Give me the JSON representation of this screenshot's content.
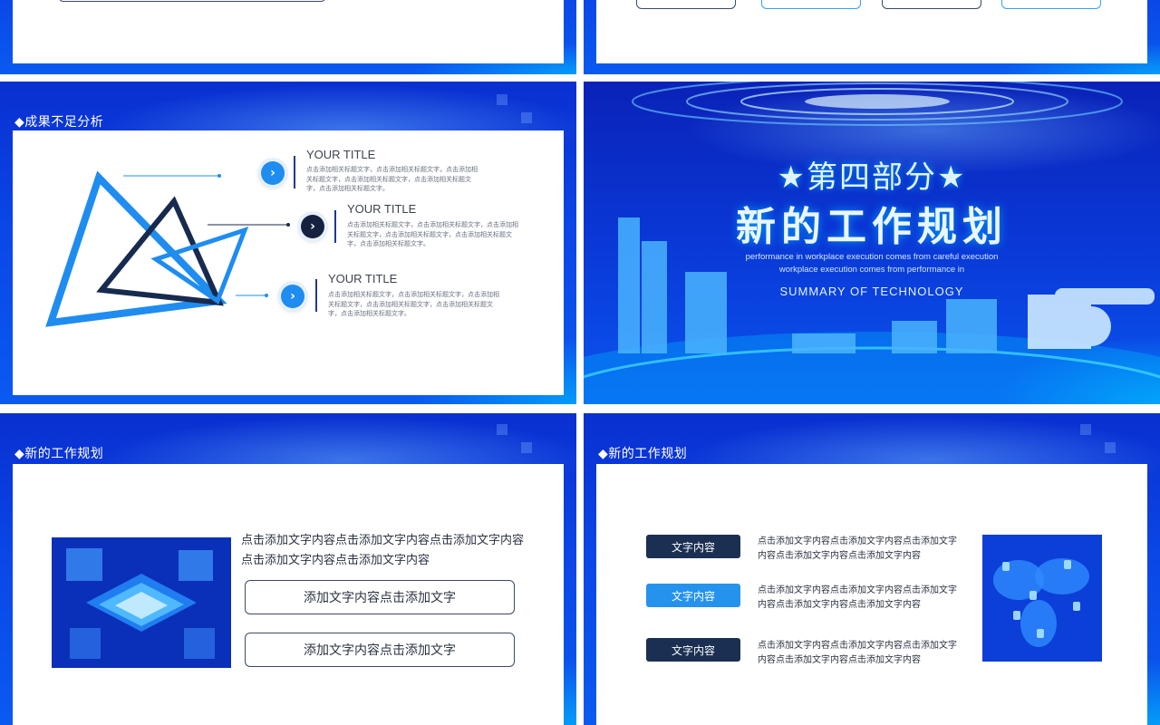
{
  "slide3": {
    "section_title": "◆成果不足分析",
    "items": [
      {
        "title": "YOUR TITLE",
        "text": "点击添加相关标题文字，点击添加相关标题文字，点击添加相关标题文字，点击添加相关标题文字，点击添加相关标题文字，点击添加相关标题文字。"
      },
      {
        "title": "YOUR TITLE",
        "text": "点击添加相关标题文字，点击添加相关标题文字，点击添加相关标题文字，点击添加相关标题文字，点击添加相关标题文字，点击添加相关标题文字。"
      },
      {
        "title": "YOUR TITLE",
        "text": "点击添加相关标题文字，点击添加相关标题文字，点击添加相关标题文字，点击添加相关标题文字，点击添加相关标题文字，点击添加相关标题文字。"
      }
    ],
    "chevron": "›"
  },
  "slide4": {
    "kicker": "★第四部分★",
    "title": "新的工作规划",
    "en_line1": "performance in workplace execution comes from careful execution",
    "en_line2": "workplace execution comes from performance in",
    "summary": "SUMMARY OF TECHNOLOGY"
  },
  "slide5": {
    "section_title": "◆新的工作规划",
    "body_line1": "点击添加文字内容点击添加文字内容点击添加文字内容",
    "body_line2": "点击添加文字内容点击添加文字内容",
    "box1": "添加文字内容点击添加文字",
    "box2": "添加文字内容点击添加文字"
  },
  "slide6": {
    "section_title": "◆新的工作规划",
    "rows": [
      {
        "label": "文字内容",
        "text1": "点击添加文字内容点击添加文字内容点击添加文字",
        "text2": "内容点击添加文字内容点击添加文字内容"
      },
      {
        "label": "文字内容",
        "text1": "点击添加文字内容点击添加文字内容点击添加文字",
        "text2": "内容点击添加文字内容点击添加文字内容"
      },
      {
        "label": "文字内容",
        "text1": "点击添加文字内容点击添加文字内容点击添加文字",
        "text2": "内容点击添加文字内容点击添加文字内容"
      }
    ]
  },
  "colors": {
    "slide_blue": "#0b46e6",
    "dark_navy": "#15213f",
    "bright_blue": "#1f8cf0",
    "pill_dark": "#1b2f52",
    "pill_light": "#2593ee"
  }
}
